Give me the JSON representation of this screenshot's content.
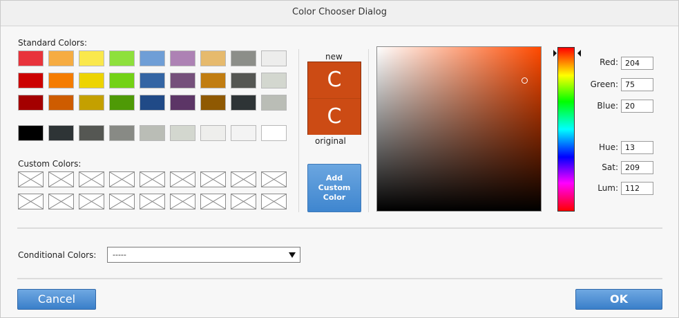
{
  "window": {
    "title": "Color Chooser Dialog"
  },
  "standard_colors": {
    "label": "Standard Colors:",
    "rows": [
      [
        "#e8333b",
        "#f6ac42",
        "#fae84c",
        "#8ee03c",
        "#6f9ed6",
        "#ad82b4",
        "#e6ba6d",
        "#8c8e89",
        "#ededec"
      ],
      [
        "#cc0000",
        "#f57c00",
        "#edd400",
        "#73d216",
        "#3465a4",
        "#75507b",
        "#c17d11",
        "#555753",
        "#d3d7cf"
      ],
      [
        "#a40000",
        "#ce5c00",
        "#c4a000",
        "#4e9a06",
        "#204a87",
        "#5c3566",
        "#8f5902",
        "#2e3436",
        "#babdb6"
      ],
      [
        "#000000",
        "#2e3436",
        "#555753",
        "#888a85",
        "#babdb6",
        "#d3d7cf",
        "#eeeeec",
        "#f3f3f3",
        "#ffffff"
      ]
    ]
  },
  "custom_colors": {
    "label": "Custom Colors:",
    "rows": 2,
    "cols": 9
  },
  "preview": {
    "new_label": "new",
    "original_label": "original",
    "glyph": "C",
    "new_color": "#cc4b14",
    "original_color": "#cc4b14"
  },
  "add_custom_button": {
    "line1": "Add",
    "line2": "Custom",
    "line3": "Color"
  },
  "rgb": {
    "red_label": "Red:",
    "red": "204",
    "green_label": "Green:",
    "green": "75",
    "blue_label": "Blue:",
    "blue": "20"
  },
  "hsl": {
    "hue_label": "Hue:",
    "hue": "13",
    "sat_label": "Sat:",
    "sat": "209",
    "lum_label": "Lum:",
    "lum": "112"
  },
  "conditional": {
    "label": "Conditional Colors:",
    "value": "-----"
  },
  "buttons": {
    "cancel": "Cancel",
    "ok": "OK"
  }
}
